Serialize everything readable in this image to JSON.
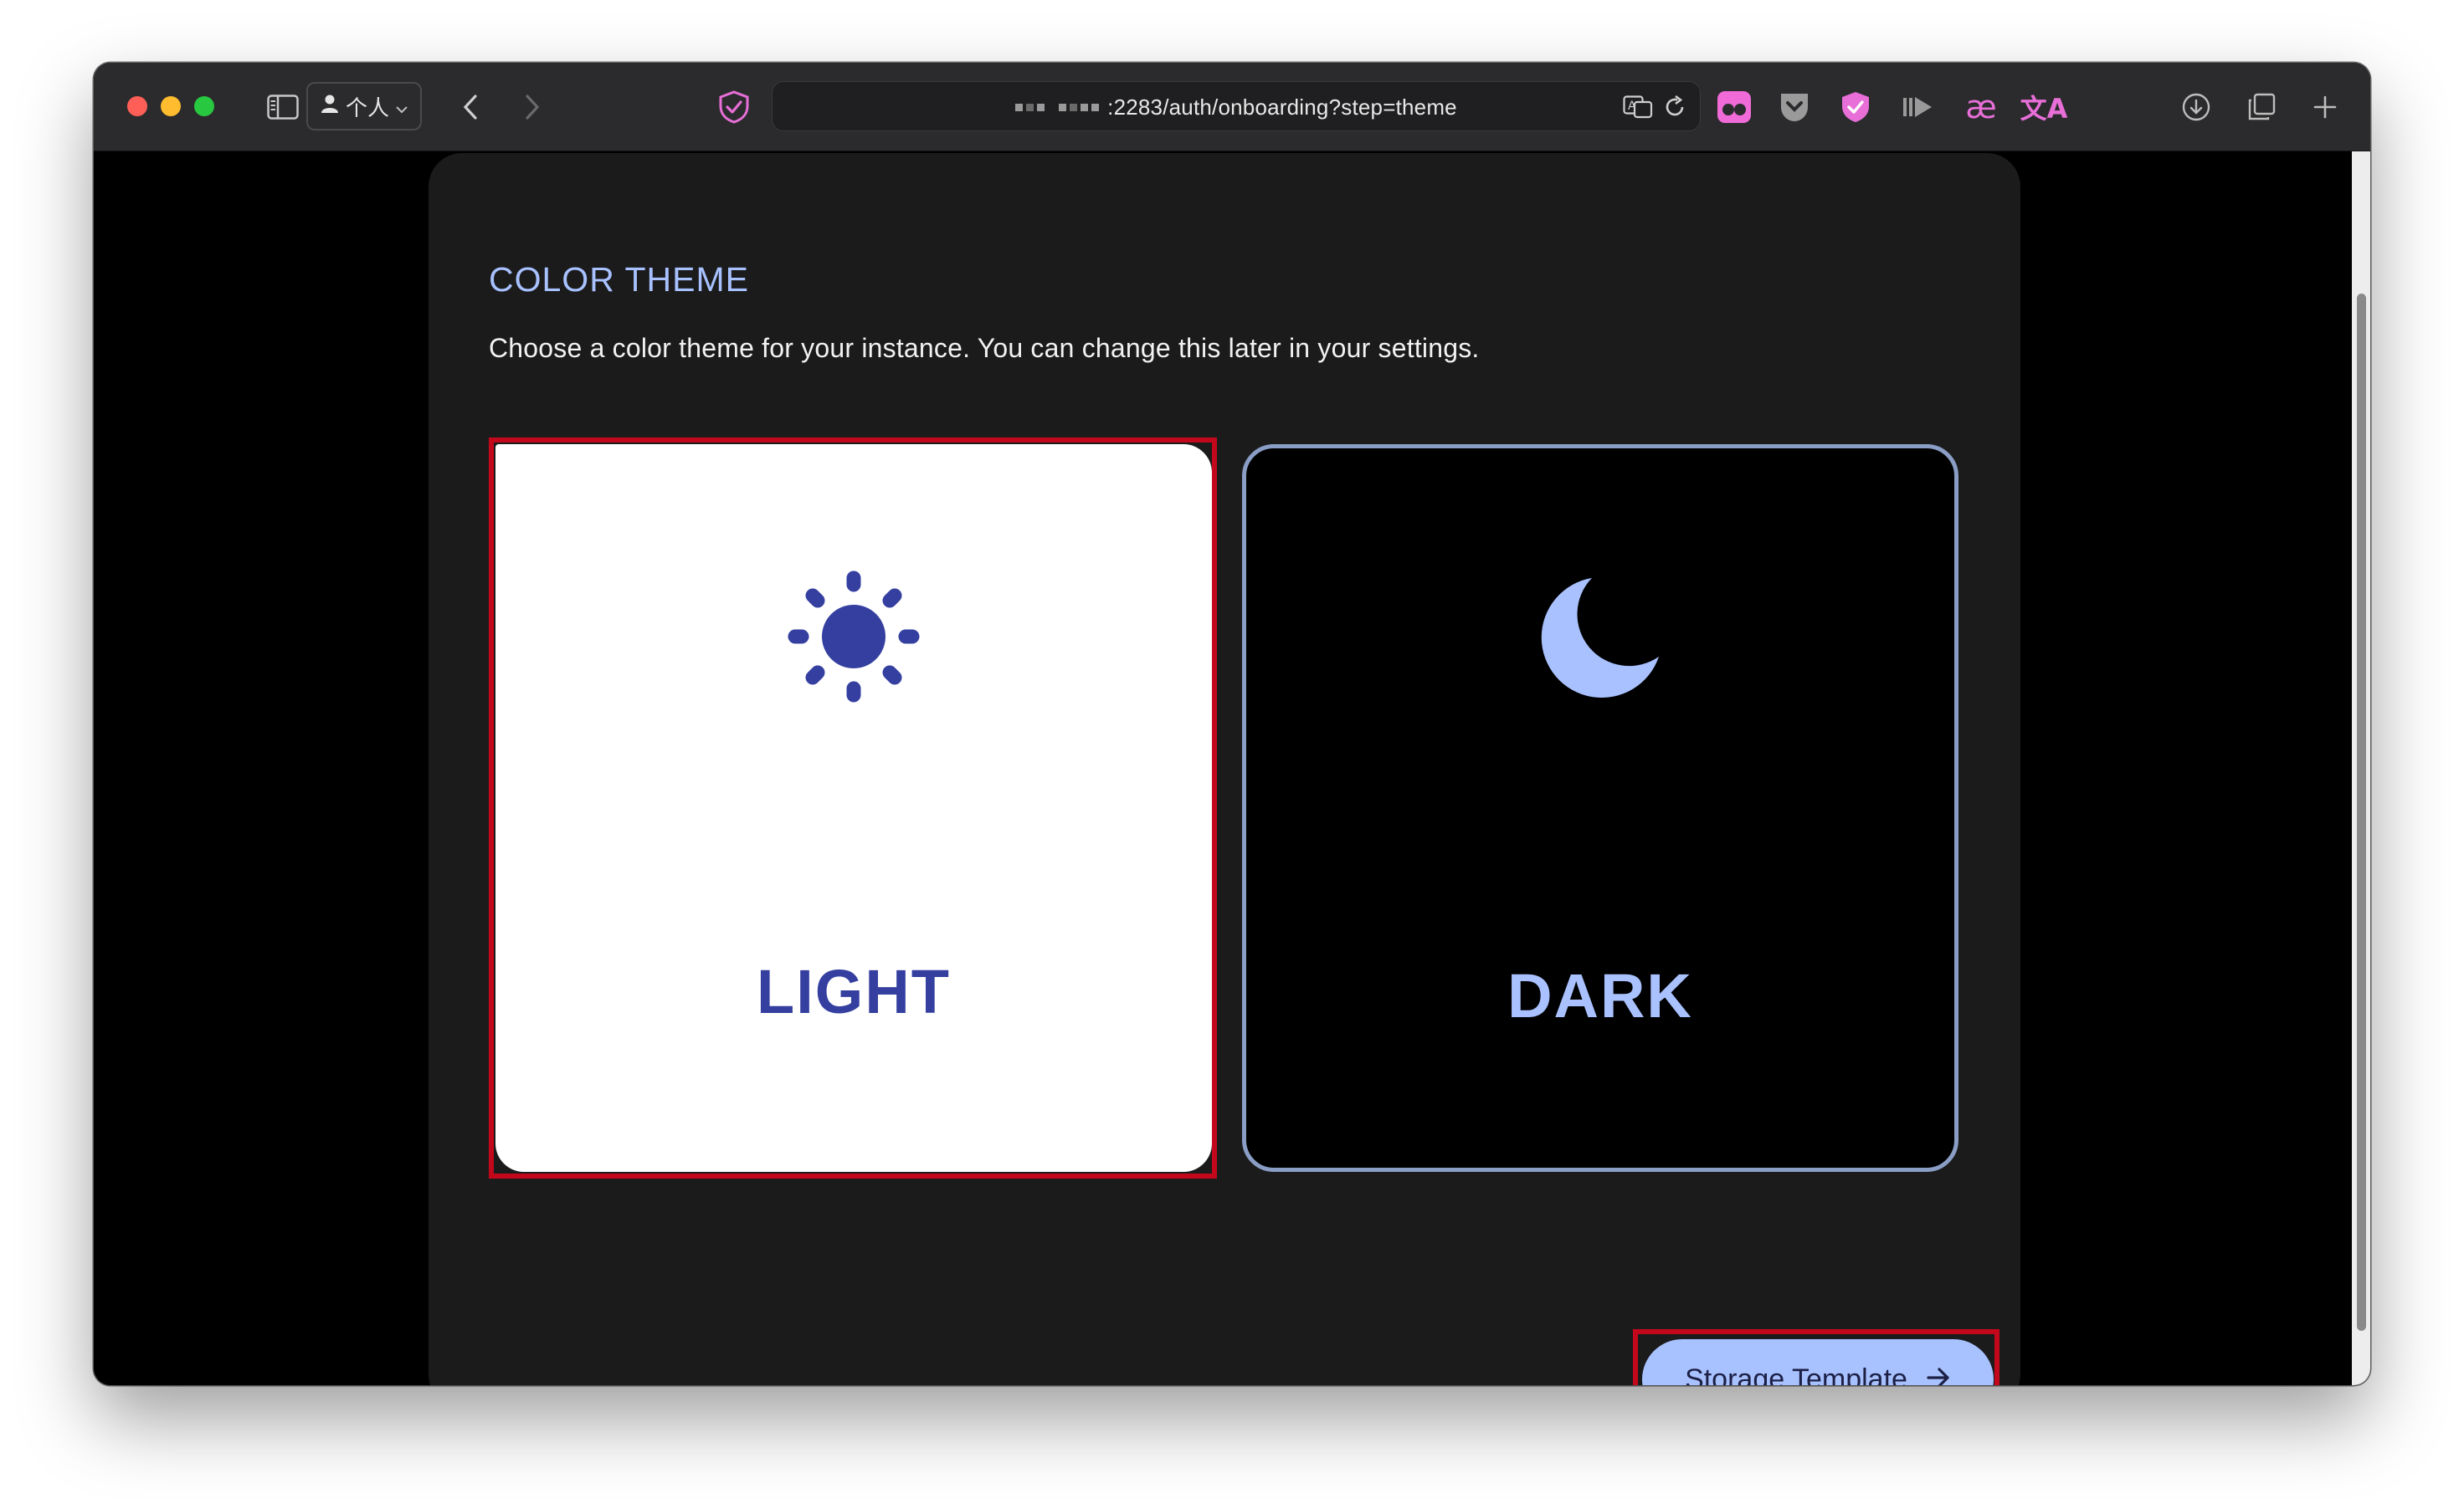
{
  "browser": {
    "profile_label": "个人",
    "url_text": ":2283/auth/onboarding?step=theme"
  },
  "page": {
    "heading": "COLOR THEME",
    "description": "Choose a color theme for your instance. You can change this later in your settings.",
    "options": [
      {
        "label": "LIGHT",
        "icon": "sun-icon",
        "selected": true
      },
      {
        "label": "DARK",
        "icon": "moon-icon",
        "selected": false
      }
    ],
    "next_button": {
      "label": "Storage Template",
      "icon": "arrow-right-icon"
    }
  },
  "colors": {
    "accent": "#a8c1ff",
    "light_text": "#343fa0",
    "panel": "#1b1b1c",
    "highlight": "#c4081c"
  }
}
